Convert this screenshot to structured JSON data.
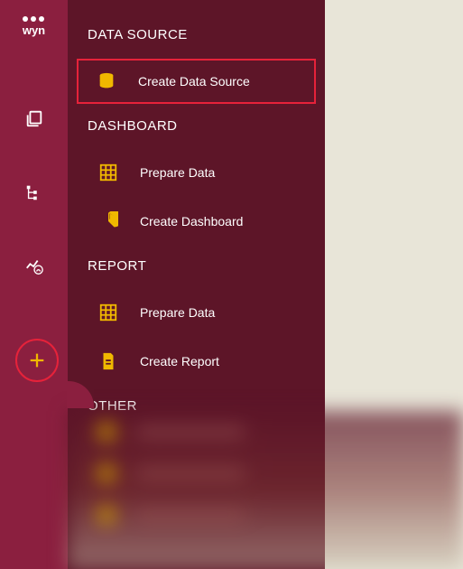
{
  "logo_text": "wyn",
  "rail": {
    "items": [
      {
        "name": "documents-icon"
      },
      {
        "name": "tree-icon"
      },
      {
        "name": "chart-alert-icon"
      }
    ]
  },
  "add_button_label": "+",
  "sections": [
    {
      "title": "DATA SOURCE",
      "items": [
        {
          "icon": "database-icon",
          "label": "Create Data Source",
          "highlighted": true
        }
      ]
    },
    {
      "title": "DASHBOARD",
      "items": [
        {
          "icon": "grid-icon",
          "label": "Prepare Data",
          "highlighted": false
        },
        {
          "icon": "pie-chart-icon",
          "label": "Create Dashboard",
          "highlighted": false
        }
      ]
    },
    {
      "title": "REPORT",
      "items": [
        {
          "icon": "grid-icon",
          "label": "Prepare Data",
          "highlighted": false
        },
        {
          "icon": "document-icon",
          "label": "Create Report",
          "highlighted": false
        }
      ]
    },
    {
      "title": "OTHER",
      "items": []
    }
  ],
  "colors": {
    "rail_bg": "#8b1f3f",
    "menu_bg": "#5d1528",
    "accent": "#e6223a",
    "icon_gold": "#f0b800"
  }
}
